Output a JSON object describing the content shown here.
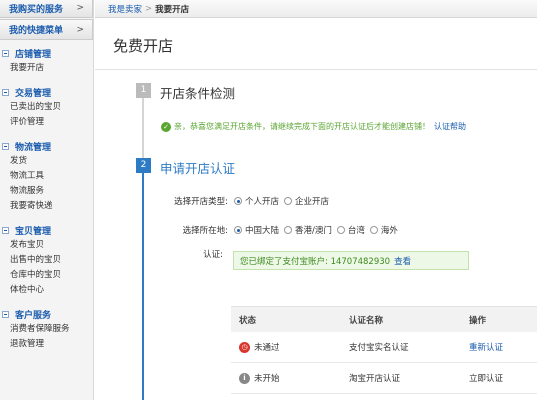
{
  "sidebar": {
    "header1": "我购买的服务",
    "header2": "我的快捷菜单",
    "arrow": ">",
    "groups": [
      {
        "title": "店铺管理",
        "items": [
          "我要开店"
        ]
      },
      {
        "title": "交易管理",
        "items": [
          "已卖出的宝贝",
          "评价管理"
        ]
      },
      {
        "title": "物流管理",
        "items": [
          "发货",
          "物流工具",
          "物流服务",
          "我要寄快递"
        ]
      },
      {
        "title": "宝贝管理",
        "items": [
          "发布宝贝",
          "出售中的宝贝",
          "仓库中的宝贝",
          "体检中心"
        ]
      },
      {
        "title": "客户服务",
        "items": [
          "消费者保障服务",
          "退款管理"
        ]
      }
    ]
  },
  "breadcrumb": {
    "home": "我是卖家",
    "sep": ">",
    "current": "我要开店"
  },
  "main": {
    "title": "免费开店",
    "step1": {
      "num": "1",
      "title": "开店条件检测"
    },
    "check": {
      "text": "亲，恭喜您满足开店条件，请继续完成下面的开店认证后才能创建店铺！",
      "link": "认证帮助"
    },
    "step2": {
      "num": "2",
      "title": "申请开店认证"
    },
    "shop_type": {
      "label": "选择开店类型:",
      "options": [
        "个人开店",
        "企业开店"
      ],
      "selected": "个人开店"
    },
    "location": {
      "label": "选择所在地:",
      "options": [
        "中国大陆",
        "香港/澳门",
        "台湾",
        "海外"
      ],
      "selected": "中国大陆"
    },
    "cert": {
      "label": "认证:",
      "text": "您已绑定了支付宝账户: 14707482930",
      "link": "查看"
    },
    "table": {
      "headers": [
        "状态",
        "认证名称",
        "操作"
      ],
      "rows": [
        {
          "status": "未通过",
          "name": "支付宝实名认证",
          "action": "重新认证",
          "icon": "clock-icon"
        },
        {
          "status": "未开始",
          "name": "淘宝开店认证",
          "action": "立即认证",
          "icon": "info-icon"
        }
      ]
    }
  }
}
